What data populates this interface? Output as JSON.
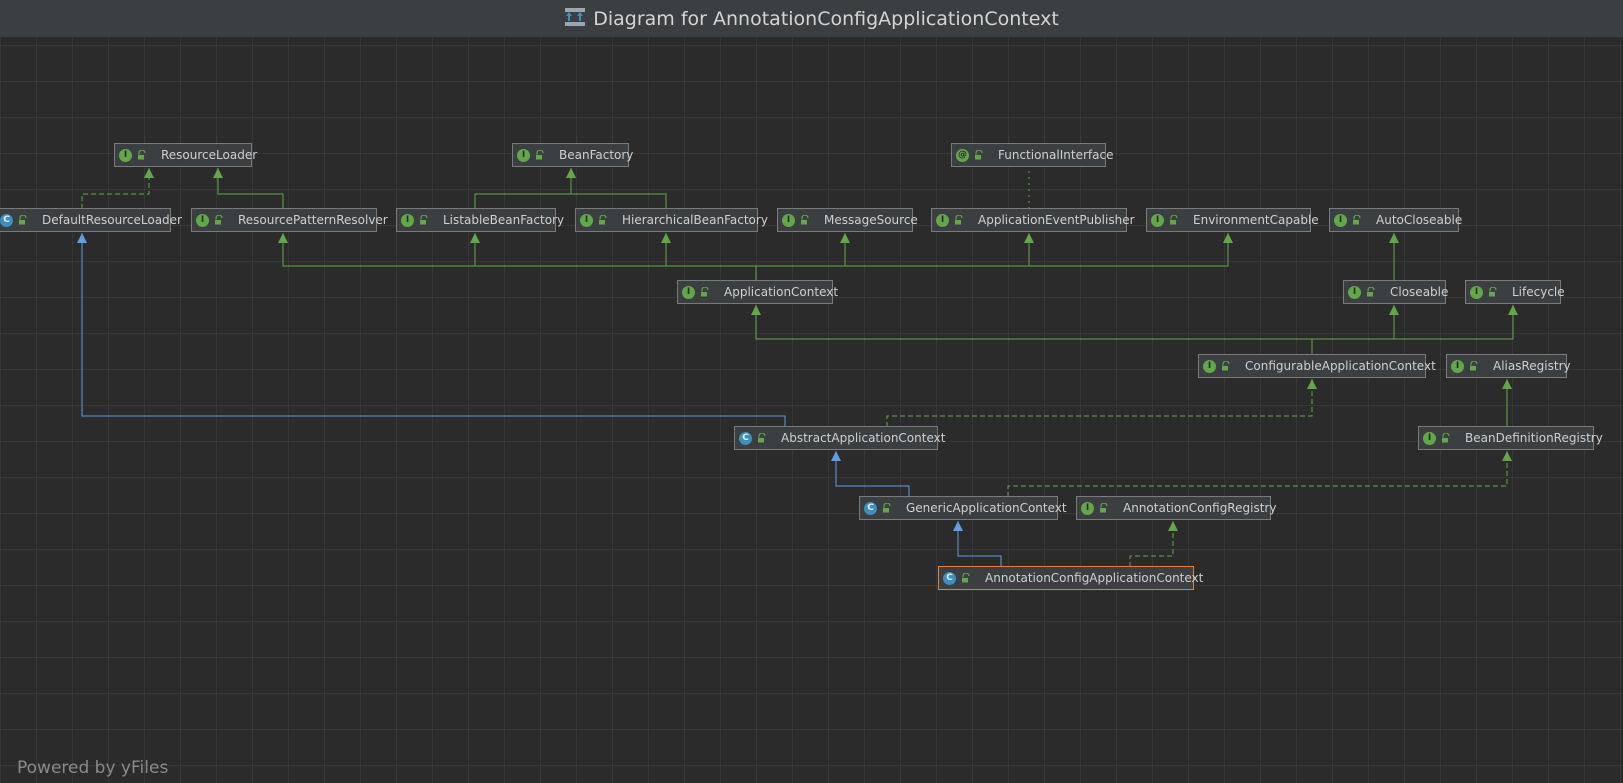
{
  "window": {
    "title": "Diagram for AnnotationConfigApplicationContext"
  },
  "watermark": "Powered by yFiles",
  "colors": {
    "background": "#2b2b2b",
    "node_fill": "#3c3f41",
    "node_border": "#7a7a7a",
    "selected_border": "#e0823d",
    "interface_edge": "#62a849",
    "class_edge": "#5c9fe6"
  },
  "nodes": [
    {
      "id": "ResourceLoader",
      "label": "ResourceLoader",
      "kind": "interface",
      "badge": "I"
    },
    {
      "id": "BeanFactory",
      "label": "BeanFactory",
      "kind": "interface",
      "badge": "I"
    },
    {
      "id": "FunctionalInterface",
      "label": "FunctionalInterface",
      "kind": "annotation",
      "badge": "@"
    },
    {
      "id": "DefaultResourceLoader",
      "label": "DefaultResourceLoader",
      "kind": "class",
      "badge": "C"
    },
    {
      "id": "ResourcePatternResolver",
      "label": "ResourcePatternResolver",
      "kind": "interface",
      "badge": "I"
    },
    {
      "id": "ListableBeanFactory",
      "label": "ListableBeanFactory",
      "kind": "interface",
      "badge": "I"
    },
    {
      "id": "HierarchicalBeanFactory",
      "label": "HierarchicalBeanFactory",
      "kind": "interface",
      "badge": "I"
    },
    {
      "id": "MessageSource",
      "label": "MessageSource",
      "kind": "interface",
      "badge": "I"
    },
    {
      "id": "ApplicationEventPublisher",
      "label": "ApplicationEventPublisher",
      "kind": "interface",
      "badge": "I"
    },
    {
      "id": "EnvironmentCapable",
      "label": "EnvironmentCapable",
      "kind": "interface",
      "badge": "I"
    },
    {
      "id": "AutoCloseable",
      "label": "AutoCloseable",
      "kind": "interface",
      "badge": "I"
    },
    {
      "id": "ApplicationContext",
      "label": "ApplicationContext",
      "kind": "interface",
      "badge": "I"
    },
    {
      "id": "Closeable",
      "label": "Closeable",
      "kind": "interface",
      "badge": "I"
    },
    {
      "id": "Lifecycle",
      "label": "Lifecycle",
      "kind": "interface",
      "badge": "I"
    },
    {
      "id": "ConfigurableApplicationContext",
      "label": "ConfigurableApplicationContext",
      "kind": "interface",
      "badge": "I"
    },
    {
      "id": "AliasRegistry",
      "label": "AliasRegistry",
      "kind": "interface",
      "badge": "I"
    },
    {
      "id": "AbstractApplicationContext",
      "label": "AbstractApplicationContext",
      "kind": "abstract",
      "badge": "C"
    },
    {
      "id": "BeanDefinitionRegistry",
      "label": "BeanDefinitionRegistry",
      "kind": "interface",
      "badge": "I"
    },
    {
      "id": "GenericApplicationContext",
      "label": "GenericApplicationContext",
      "kind": "class",
      "badge": "C"
    },
    {
      "id": "AnnotationConfigRegistry",
      "label": "AnnotationConfigRegistry",
      "kind": "interface",
      "badge": "I"
    },
    {
      "id": "AnnotationConfigApplicationContext",
      "label": "AnnotationConfigApplicationContext",
      "kind": "class",
      "badge": "C",
      "selected": true
    }
  ],
  "edges": [
    {
      "from": "DefaultResourceLoader",
      "to": "ResourceLoader",
      "type": "implements"
    },
    {
      "from": "ResourcePatternResolver",
      "to": "ResourceLoader",
      "type": "extends-interface"
    },
    {
      "from": "ListableBeanFactory",
      "to": "BeanFactory",
      "type": "extends-interface"
    },
    {
      "from": "HierarchicalBeanFactory",
      "to": "BeanFactory",
      "type": "extends-interface"
    },
    {
      "from": "ApplicationEventPublisher",
      "to": "FunctionalInterface",
      "type": "annotated-with"
    },
    {
      "from": "ApplicationContext",
      "to": "ResourcePatternResolver",
      "type": "extends-interface"
    },
    {
      "from": "ApplicationContext",
      "to": "ListableBeanFactory",
      "type": "extends-interface"
    },
    {
      "from": "ApplicationContext",
      "to": "HierarchicalBeanFactory",
      "type": "extends-interface"
    },
    {
      "from": "ApplicationContext",
      "to": "MessageSource",
      "type": "extends-interface"
    },
    {
      "from": "ApplicationContext",
      "to": "ApplicationEventPublisher",
      "type": "extends-interface"
    },
    {
      "from": "ApplicationContext",
      "to": "EnvironmentCapable",
      "type": "extends-interface"
    },
    {
      "from": "Closeable",
      "to": "AutoCloseable",
      "type": "extends-interface"
    },
    {
      "from": "ConfigurableApplicationContext",
      "to": "ApplicationContext",
      "type": "extends-interface"
    },
    {
      "from": "ConfigurableApplicationContext",
      "to": "Closeable",
      "type": "extends-interface"
    },
    {
      "from": "ConfigurableApplicationContext",
      "to": "Lifecycle",
      "type": "extends-interface"
    },
    {
      "from": "BeanDefinitionRegistry",
      "to": "AliasRegistry",
      "type": "extends-interface"
    },
    {
      "from": "AbstractApplicationContext",
      "to": "DefaultResourceLoader",
      "type": "extends-class"
    },
    {
      "from": "AbstractApplicationContext",
      "to": "ConfigurableApplicationContext",
      "type": "implements"
    },
    {
      "from": "GenericApplicationContext",
      "to": "AbstractApplicationContext",
      "type": "extends-class"
    },
    {
      "from": "GenericApplicationContext",
      "to": "BeanDefinitionRegistry",
      "type": "implements"
    },
    {
      "from": "AnnotationConfigApplicationContext",
      "to": "GenericApplicationContext",
      "type": "extends-class"
    },
    {
      "from": "AnnotationConfigApplicationContext",
      "to": "AnnotationConfigRegistry",
      "type": "implements"
    }
  ]
}
